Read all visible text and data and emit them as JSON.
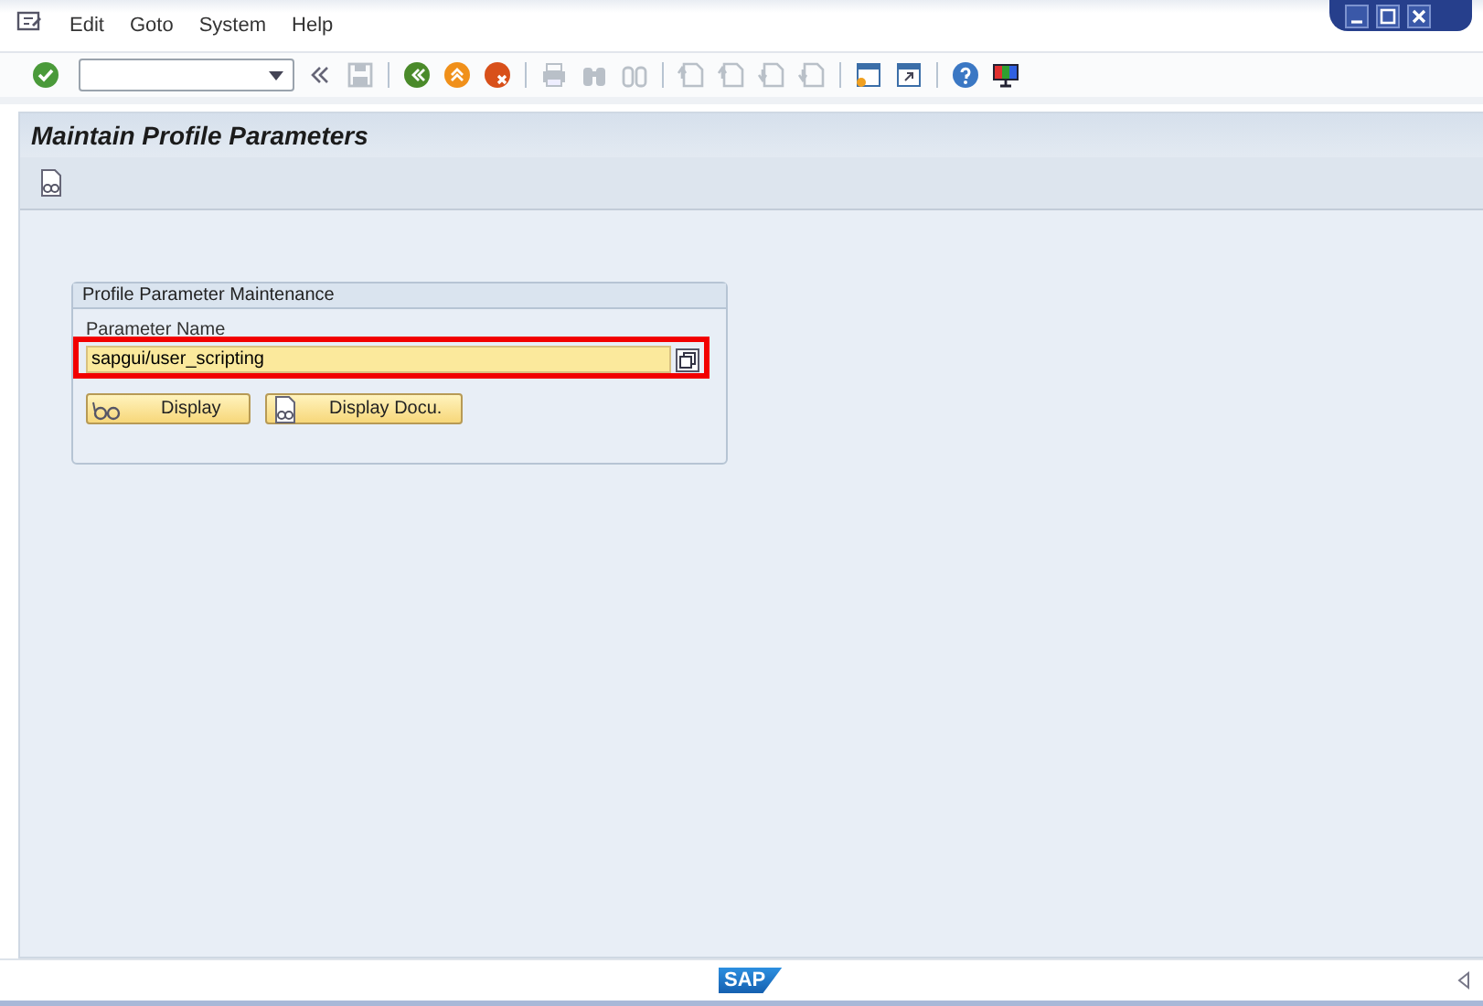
{
  "menu": [
    "Edit",
    "Goto",
    "System",
    "Help"
  ],
  "screen": {
    "title": "Maintain Profile Parameters"
  },
  "group": {
    "title": "Profile Parameter Maintenance",
    "field": {
      "label": "Parameter Name",
      "value": "sapgui/user_scripting",
      "highlighted": true
    },
    "buttons": [
      {
        "label": "Display",
        "kind": "display"
      },
      {
        "label": "Display Docu.",
        "kind": "docu"
      }
    ]
  },
  "status_bar": {
    "logo": "SAP"
  }
}
